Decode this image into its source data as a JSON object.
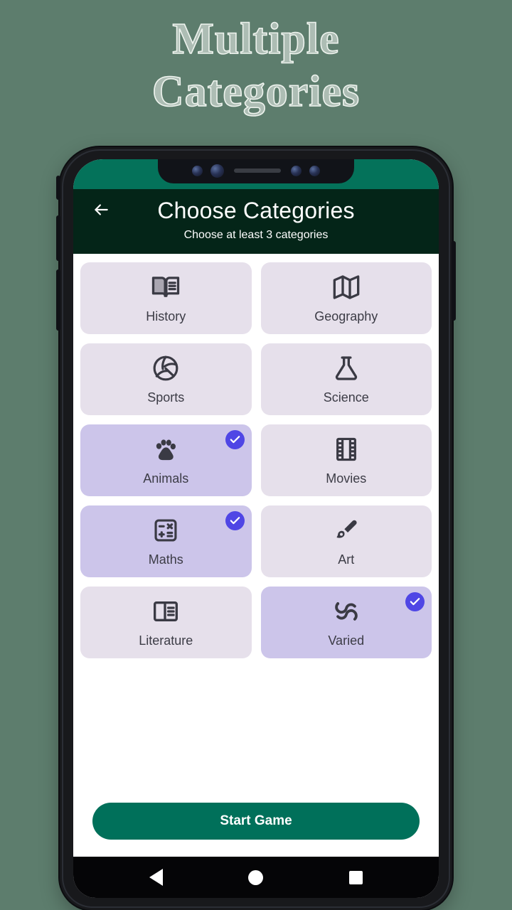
{
  "promo": {
    "title_line1": "Multiple",
    "title_line2": "Categories"
  },
  "colors": {
    "page_background": "#5D7D6D",
    "status_bar": "#04725A",
    "app_bar": "#042518",
    "card_unselected": "#E6E0EB",
    "card_selected": "#CCC5EA",
    "check_badge": "#4F46E5",
    "primary_button": "#00705A",
    "icon": "#3A3A44",
    "label_text": "#3C3C46"
  },
  "app_bar": {
    "back_icon": "arrow-left-icon",
    "title": "Choose Categories",
    "subtitle": "Choose at least 3 categories"
  },
  "categories": [
    {
      "label": "History",
      "icon": "open-book-icon",
      "selected": false
    },
    {
      "label": "Geography",
      "icon": "map-icon",
      "selected": false
    },
    {
      "label": "Sports",
      "icon": "volleyball-icon",
      "selected": false
    },
    {
      "label": "Science",
      "icon": "flask-icon",
      "selected": false
    },
    {
      "label": "Animals",
      "icon": "paw-icon",
      "selected": true
    },
    {
      "label": "Movies",
      "icon": "film-strip-icon",
      "selected": false
    },
    {
      "label": "Maths",
      "icon": "calculator-icon",
      "selected": true
    },
    {
      "label": "Art",
      "icon": "paintbrush-icon",
      "selected": false
    },
    {
      "label": "Literature",
      "icon": "article-icon",
      "selected": false
    },
    {
      "label": "Varied",
      "icon": "infinity-icon",
      "selected": true
    }
  ],
  "selected_count": 3,
  "primary_action": {
    "label": "Start Game"
  },
  "nav_bar": {
    "back": "nav-back-icon",
    "home": "nav-home-icon",
    "recents": "nav-recents-icon"
  }
}
